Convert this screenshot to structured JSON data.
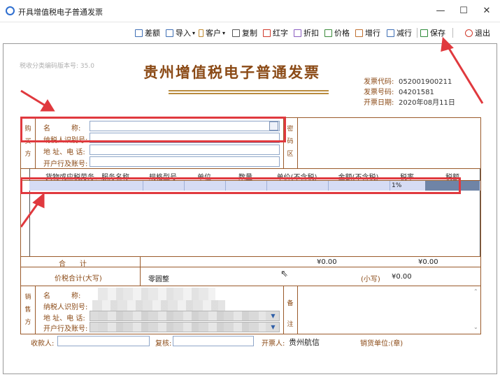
{
  "window": {
    "title": "开具增值税电子普通发票",
    "controls": {
      "minimize": "—",
      "maximize": "☐",
      "close": "✕"
    }
  },
  "toolbar": {
    "items": [
      {
        "label": "差额",
        "icon": "list-icon"
      },
      {
        "label": "导入",
        "icon": "import-icon",
        "dropdown": true
      },
      {
        "label": "客户",
        "icon": "customer-icon",
        "dropdown": true
      },
      {
        "label": "复制",
        "icon": "copy-icon"
      },
      {
        "label": "红字",
        "icon": "red-invoice-icon"
      },
      {
        "label": "折扣",
        "icon": "discount-icon"
      },
      {
        "label": "价格",
        "icon": "price-icon"
      },
      {
        "label": "增行",
        "icon": "add-row-icon"
      },
      {
        "label": "减行",
        "icon": "remove-row-icon"
      },
      {
        "label": "保存",
        "icon": "printer-save-icon"
      },
      {
        "label": "退出",
        "icon": "power-icon"
      }
    ],
    "dropdown_glyph": "▾"
  },
  "invoice": {
    "tax_code_version": "税收分类编码版本号: 35.0",
    "title": "贵州增值税电子普通发票",
    "meta": {
      "code_label": "发票代码:",
      "code_value": "052001900211",
      "number_label": "发票号码:",
      "number_value": "04201581",
      "date_label": "开票日期:",
      "date_value": "2020年08月11日"
    },
    "buyer": {
      "section_chars": [
        "购",
        "买",
        "方"
      ],
      "name_label": "名　　　称:",
      "taxid_label": "纳税人识别号:",
      "address_label": "地 址、电 话:",
      "bank_label": "开户行及账号:"
    },
    "password_area_chars": [
      "密",
      "码",
      "区"
    ],
    "columns": [
      "货物或应税劳务、服务名称",
      "规格型号",
      "单位",
      "数量",
      "单价(不含税)",
      "金额(不含税)",
      "税率",
      "税额"
    ],
    "row": {
      "tax_rate": "1%"
    },
    "total": {
      "label": "合　　计",
      "amount": "¥0.00",
      "tax": "¥0.00"
    },
    "grand_total": {
      "label": "价税合计(大写)",
      "uppercase": "零圆整",
      "small_label": "(小写)",
      "small_value": "¥0.00"
    },
    "seller": {
      "section_chars": [
        "销",
        "售",
        "方"
      ],
      "name_label": "名　　　称:",
      "taxid_label": "纳税人识别号:",
      "address_label": "地 址、电 话:",
      "bank_label": "开户行及账号:"
    },
    "remark_chars": [
      "备",
      "注"
    ],
    "footer": {
      "payee_label": "收款人:",
      "reviewer_label": "复核:",
      "issuer_label": "开票人:",
      "issuer_value": "贵州航信",
      "seller_unit_label": "销货单位:(章)"
    }
  },
  "colors": {
    "accent": "#8b4a16",
    "frame": "#9a5a2a",
    "highlight": "#e0393e",
    "row": "#d6dcf4"
  }
}
